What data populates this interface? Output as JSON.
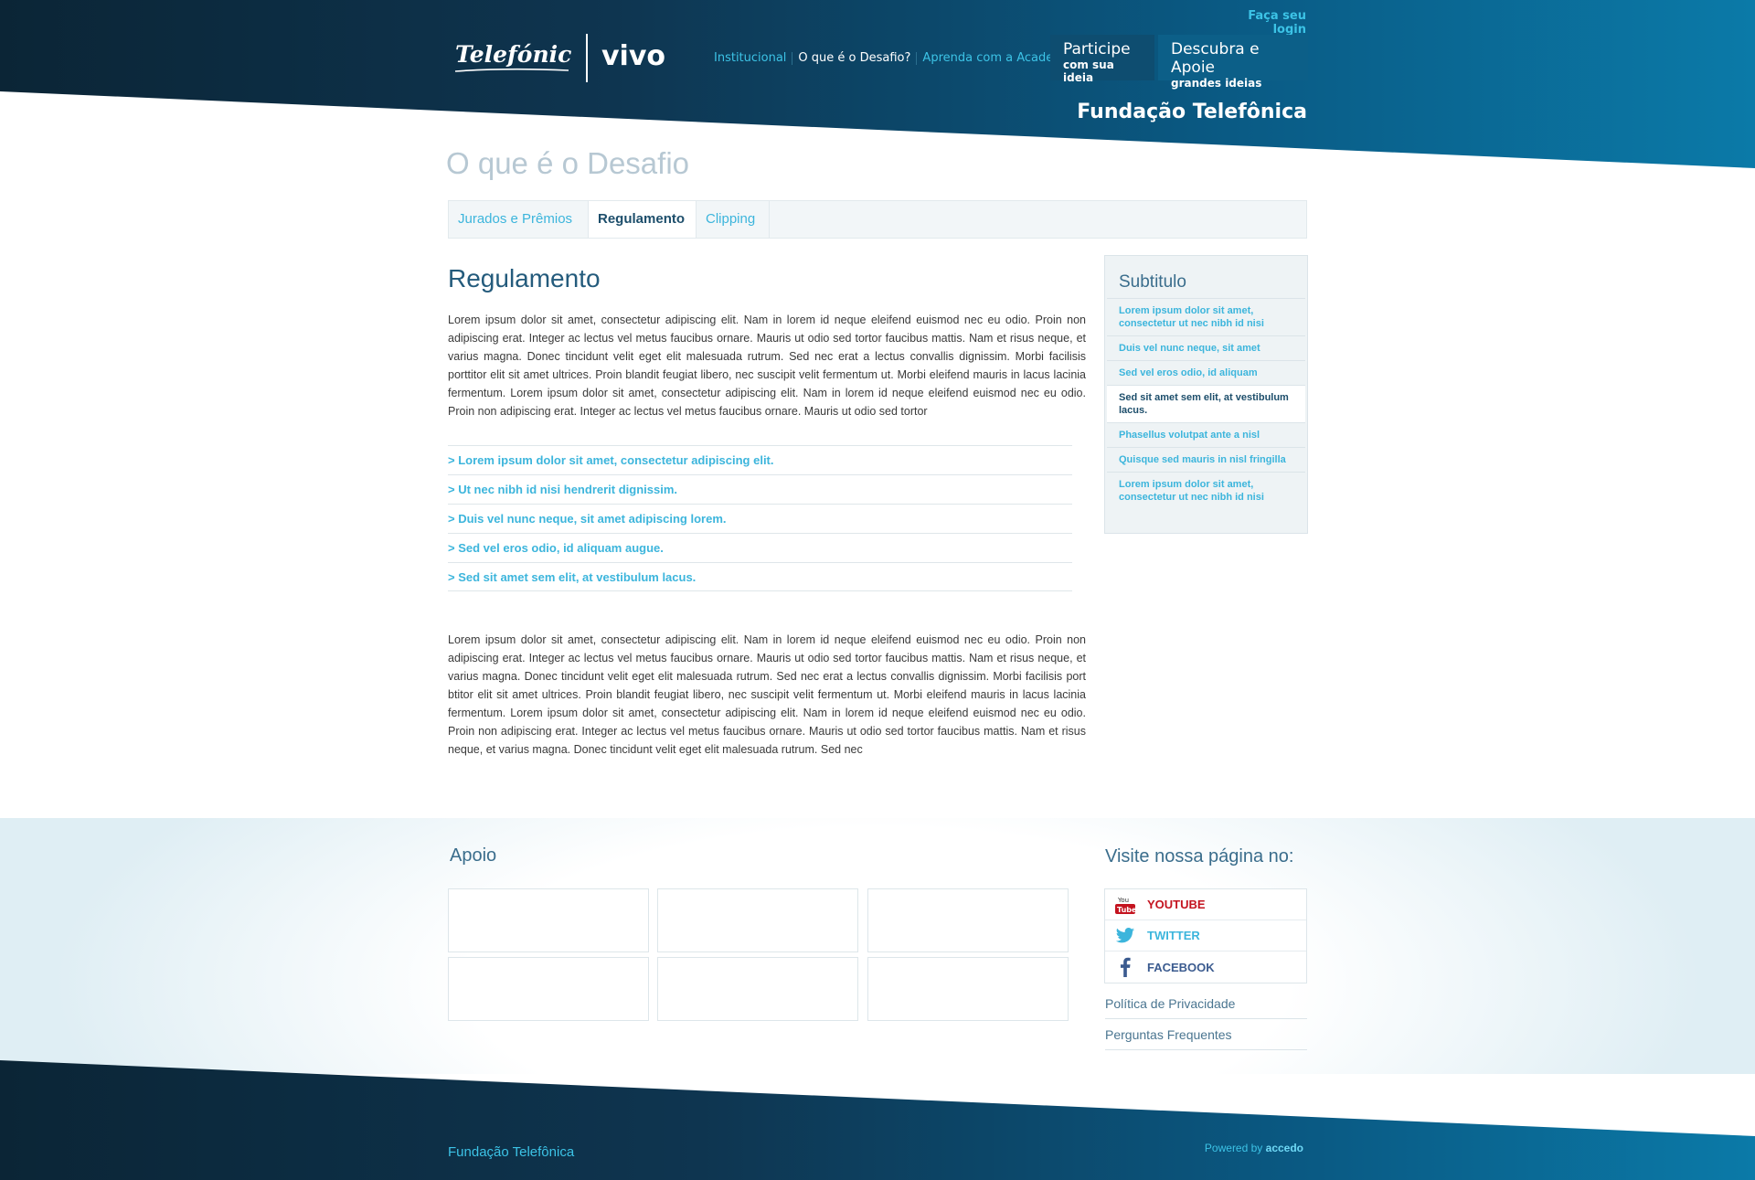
{
  "header": {
    "login_label": "Faça seu login",
    "logo_telefonica": "Telefónica",
    "logo_vivo": "vivo",
    "nav": [
      {
        "label": "Institucional",
        "active": false
      },
      {
        "label": "O que é o Desafio?",
        "active": true
      },
      {
        "label": "Aprenda com a Academia",
        "active": false
      }
    ],
    "cta_participe": {
      "line1": "Participe",
      "line2": "com sua ideia"
    },
    "cta_descubra": {
      "line1": "Descubra e Apoie",
      "line2": "grandes ideias"
    },
    "foundation": "Fundação Telefônica"
  },
  "page_title": "O que é o Desafio",
  "tabs": [
    {
      "label": "Jurados e Prêmios",
      "active": false
    },
    {
      "label": "Regulamento",
      "active": true
    },
    {
      "label": "Clipping",
      "active": false
    }
  ],
  "main": {
    "heading": "Regulamento",
    "paragraph1": "Lorem ipsum dolor sit amet, consectetur adipiscing elit. Nam in lorem id neque eleifend euismod nec eu odio. Proin non adipiscing erat. Integer ac lectus vel metus faucibus ornare. Mauris ut odio sed tortor faucibus mattis. Nam et risus neque, et varius magna. Donec tincidunt velit eget elit malesuada rutrum. Sed nec erat a lectus convallis dignissim. Morbi facilisis porttitor elit sit amet ultrices. Proin blandit feugiat libero, nec suscipit velit fermentum ut. Morbi eleifend mauris in lacus lacinia fermentum. Lorem ipsum dolor sit amet, consectetur adipiscing elit. Nam in lorem id neque eleifend euismod nec eu odio. Proin non adipiscing erat. Integer ac lectus vel metus faucibus ornare. Mauris ut odio sed tortor",
    "links": [
      "> Lorem ipsum dolor sit amet, consectetur adipiscing elit.",
      "> Ut nec nibh id nisi hendrerit dignissim.",
      "> Duis vel nunc neque, sit amet adipiscing lorem.",
      "> Sed vel eros odio, id aliquam augue.",
      "> Sed sit amet sem elit, at vestibulum lacus."
    ],
    "paragraph2": "Lorem ipsum dolor sit amet, consectetur adipiscing elit. Nam in lorem id neque eleifend euismod nec eu odio. Proin non adipiscing erat. Integer ac lectus vel metus faucibus ornare. Mauris ut odio sed tortor faucibus mattis. Nam et risus neque, et varius magna. Donec tincidunt velit eget elit malesuada rutrum. Sed nec erat a lectus convallis dignissim. Morbi facilisis port btitor elit sit amet ultrices. Proin blandit feugiat libero, nec suscipit velit fermentum ut. Morbi eleifend mauris in lacus lacinia fermentum. Lorem ipsum dolor sit amet, consectetur adipiscing elit. Nam in lorem id neque eleifend euismod nec eu odio. Proin non adipiscing erat. Integer ac lectus vel metus faucibus ornare. Mauris ut odio sed tortor faucibus mattis. Nam et risus neque, et varius magna. Donec tincidunt velit eget elit malesuada rutrum. Sed nec"
  },
  "sidebar": {
    "title": "Subtitulo",
    "items": [
      {
        "label": "Lorem ipsum dolor sit amet, consectetur ut nec nibh id nisi",
        "active": false
      },
      {
        "label": "Duis vel nunc neque, sit amet",
        "active": false
      },
      {
        "label": "Sed vel eros odio, id aliquam",
        "active": false
      },
      {
        "label": "Sed sit amet sem elit, at vestibulum lacus.",
        "active": true
      },
      {
        "label": "Phasellus volutpat ante a nisl",
        "active": false
      },
      {
        "label": "Quisque sed mauris in nisl fringilla",
        "active": false
      },
      {
        "label": "Lorem ipsum dolor sit amet, consectetur ut nec nibh id nisi",
        "active": false
      }
    ]
  },
  "footer": {
    "apoio_title": "Apoio",
    "visit_title": "Visite nossa página no:",
    "social": [
      {
        "label": "YOUTUBE",
        "icon": "youtube-icon",
        "color": "#c4131f"
      },
      {
        "label": "TWITTER",
        "icon": "twitter-icon",
        "color": "#3cb5dc"
      },
      {
        "label": "FACEBOOK",
        "icon": "facebook-icon",
        "color": "#3b5b8f"
      }
    ],
    "links": [
      "Política de Privacidade",
      "Perguntas Frequentes"
    ],
    "brand": "Fundação Telefônica",
    "powered_prefix": "Powered by",
    "powered_brand": "accedo"
  }
}
